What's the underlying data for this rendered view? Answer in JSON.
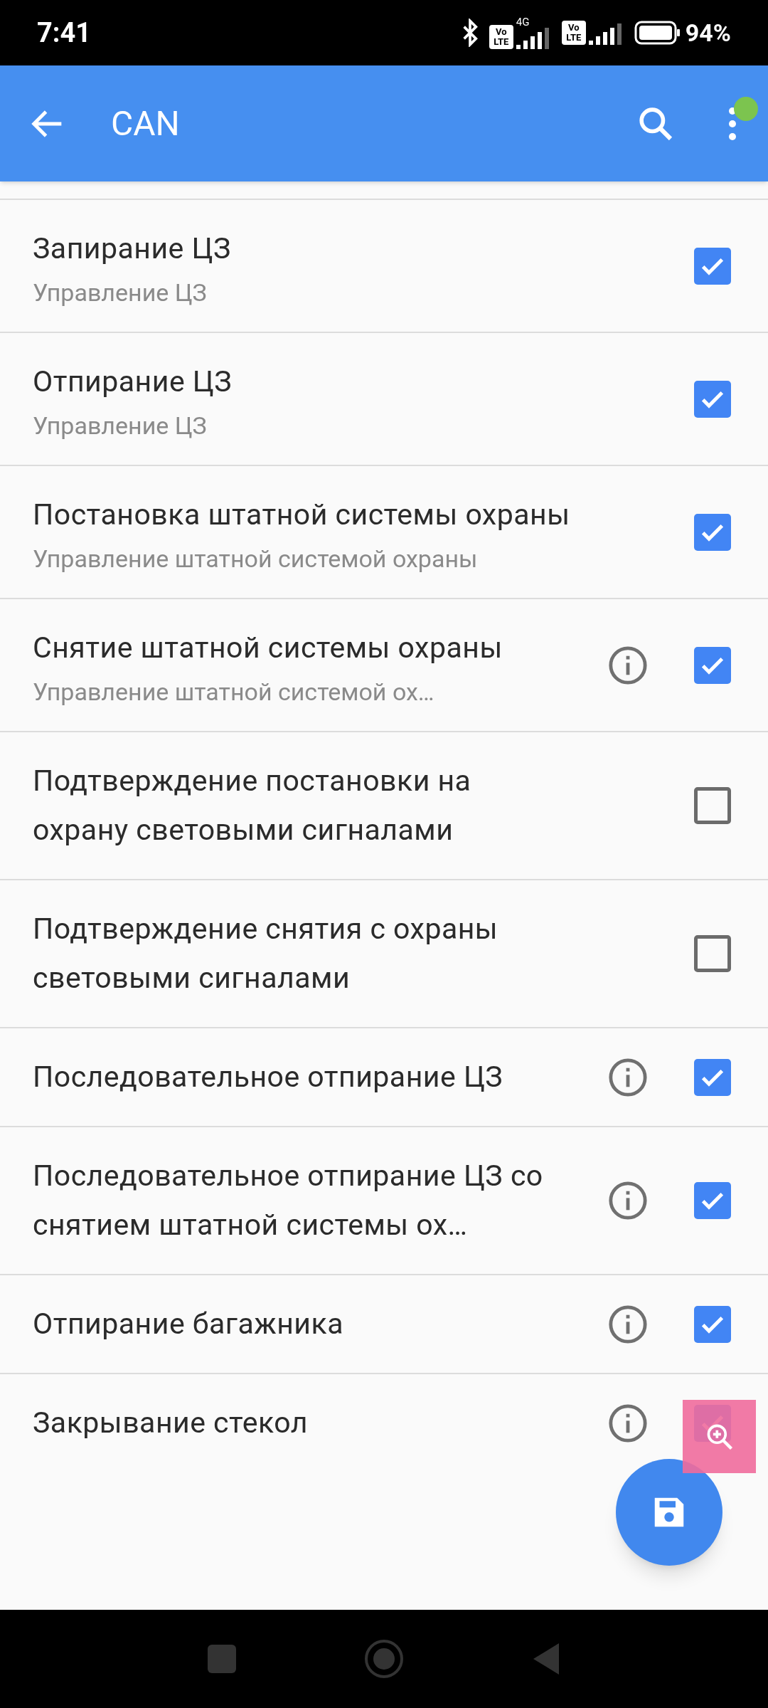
{
  "status_bar": {
    "time": "7:41",
    "sims": [
      {
        "badge": [
          "Vo",
          "LTE"
        ],
        "network": "4G"
      },
      {
        "badge": [
          "Vo",
          "LTE"
        ]
      }
    ],
    "battery": "94%"
  },
  "app_bar": {
    "title": "CAN",
    "notification_dot": true
  },
  "items": [
    {
      "title": "Запирание ЦЗ",
      "subtitle": "Управление ЦЗ",
      "info": false,
      "checked": true
    },
    {
      "title": "Отпирание ЦЗ",
      "subtitle": "Управление ЦЗ",
      "info": false,
      "checked": true
    },
    {
      "title": "Постановка штатной системы охраны",
      "subtitle": "Управление штатной системой охраны",
      "info": false,
      "checked": true
    },
    {
      "title": "Снятие штатной системы охраны",
      "subtitle": "Управление штатной системой ох…",
      "info": true,
      "checked": true
    },
    {
      "title": "Подтверждение постановки на охрану световыми сигналами",
      "info": false,
      "checked": false
    },
    {
      "title": "Подтверждение снятия с охраны световыми сигналами",
      "info": false,
      "checked": false
    },
    {
      "title": "Последовательное отпирание ЦЗ",
      "info": true,
      "checked": true
    },
    {
      "title": "Последовательное отпирание ЦЗ со снятием штатной системы ох…",
      "info": true,
      "checked": true
    },
    {
      "title": "Отпирание багажника",
      "info": true,
      "checked": true
    },
    {
      "title": "Закрывание стекол",
      "info": true,
      "checked": true
    }
  ]
}
